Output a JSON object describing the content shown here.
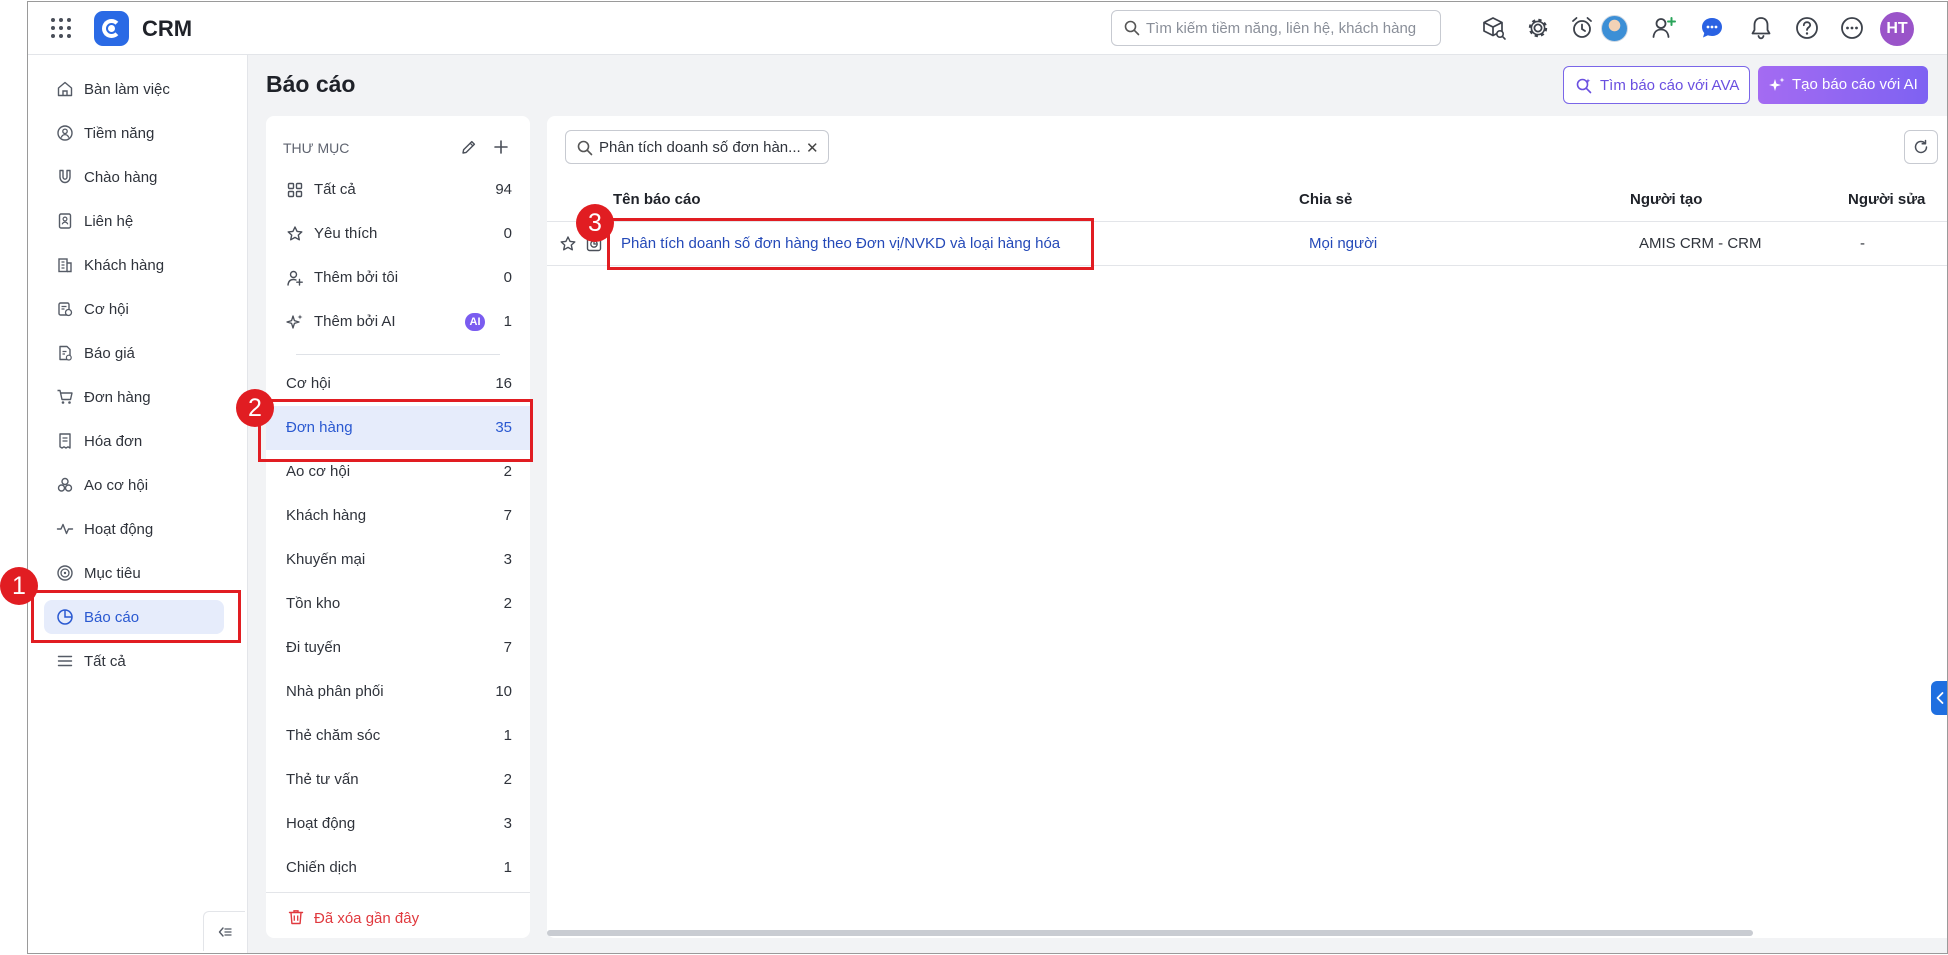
{
  "app": {
    "title": "CRM"
  },
  "search": {
    "placeholder": "Tìm kiếm tiềm năng, liên hệ, khách hàng"
  },
  "user": {
    "initials": "HT"
  },
  "sidebar": {
    "items": [
      {
        "label": "Bàn làm việc",
        "icon": "home-icon",
        "active": false
      },
      {
        "label": "Tiềm năng",
        "icon": "target-user-icon",
        "active": false
      },
      {
        "label": "Chào hàng",
        "icon": "magnet-icon",
        "active": false
      },
      {
        "label": "Liên hệ",
        "icon": "contact-card-icon",
        "active": false
      },
      {
        "label": "Khách hàng",
        "icon": "building-icon",
        "active": false
      },
      {
        "label": "Cơ hội",
        "icon": "opportunity-icon",
        "active": false
      },
      {
        "label": "Báo giá",
        "icon": "quote-icon",
        "active": false
      },
      {
        "label": "Đơn hàng",
        "icon": "cart-icon",
        "active": false
      },
      {
        "label": "Hóa đơn",
        "icon": "invoice-icon",
        "active": false
      },
      {
        "label": "Ao cơ hội",
        "icon": "pool-icon",
        "active": false
      },
      {
        "label": "Hoạt động",
        "icon": "activity-icon",
        "active": false
      },
      {
        "label": "Mục tiêu",
        "icon": "goal-icon",
        "active": false
      },
      {
        "label": "Báo cáo",
        "icon": "pie-chart-icon",
        "active": true
      },
      {
        "label": "Tất cả",
        "icon": "menu-icon",
        "active": false
      }
    ]
  },
  "page": {
    "title": "Báo cáo",
    "btn_ava": "Tìm báo cáo với AVA",
    "btn_ai": "Tạo báo cáo với AI"
  },
  "folders": {
    "header": "THƯ MỤC",
    "top": [
      {
        "label": "Tất cả",
        "count": "94",
        "icon": "grid-icon"
      },
      {
        "label": "Yêu thích",
        "count": "0",
        "icon": "star-icon"
      },
      {
        "label": "Thêm bởi tôi",
        "count": "0",
        "icon": "user-add-icon"
      },
      {
        "label": "Thêm bởi AI",
        "count": "1",
        "icon": "sparkle-icon",
        "badge": "AI"
      }
    ],
    "list": [
      {
        "label": "Cơ hội",
        "count": "16",
        "active": false
      },
      {
        "label": "Đơn hàng",
        "count": "35",
        "active": true
      },
      {
        "label": "Ao cơ hội",
        "count": "2",
        "active": false
      },
      {
        "label": "Khách hàng",
        "count": "7",
        "active": false
      },
      {
        "label": "Khuyến mại",
        "count": "3",
        "active": false
      },
      {
        "label": "Tồn kho",
        "count": "2",
        "active": false
      },
      {
        "label": "Đi tuyến",
        "count": "7",
        "active": false
      },
      {
        "label": "Nhà phân phối",
        "count": "10",
        "active": false
      },
      {
        "label": "Thẻ chăm sóc",
        "count": "1",
        "active": false
      },
      {
        "label": "Thẻ tư vấn",
        "count": "2",
        "active": false
      },
      {
        "label": "Hoạt động",
        "count": "3",
        "active": false
      },
      {
        "label": "Chiến dịch",
        "count": "1",
        "active": false
      }
    ],
    "trash": "Đã xóa gần đây"
  },
  "report_list": {
    "filter": "Phân tích doanh số đơn hàn...",
    "columns": [
      "Tên báo cáo",
      "Chia sẻ",
      "Người tạo",
      "Người sửa"
    ],
    "rows": [
      {
        "name": "Phân tích doanh số đơn hàng theo Đơn vị/NVKD và loại hàng hóa",
        "share": "Mọi người",
        "creator": "AMIS CRM - CRM",
        "modifier": "-"
      }
    ]
  },
  "annotations": [
    "1",
    "2",
    "3"
  ],
  "colors": {
    "accent": "#2a59d1",
    "active_bg": "#e6ecfb",
    "highlight": "#e11d22",
    "ai_gradient_start": "#a46bf2",
    "ai_gradient_end": "#7e62f2",
    "danger": "#e0393e"
  }
}
